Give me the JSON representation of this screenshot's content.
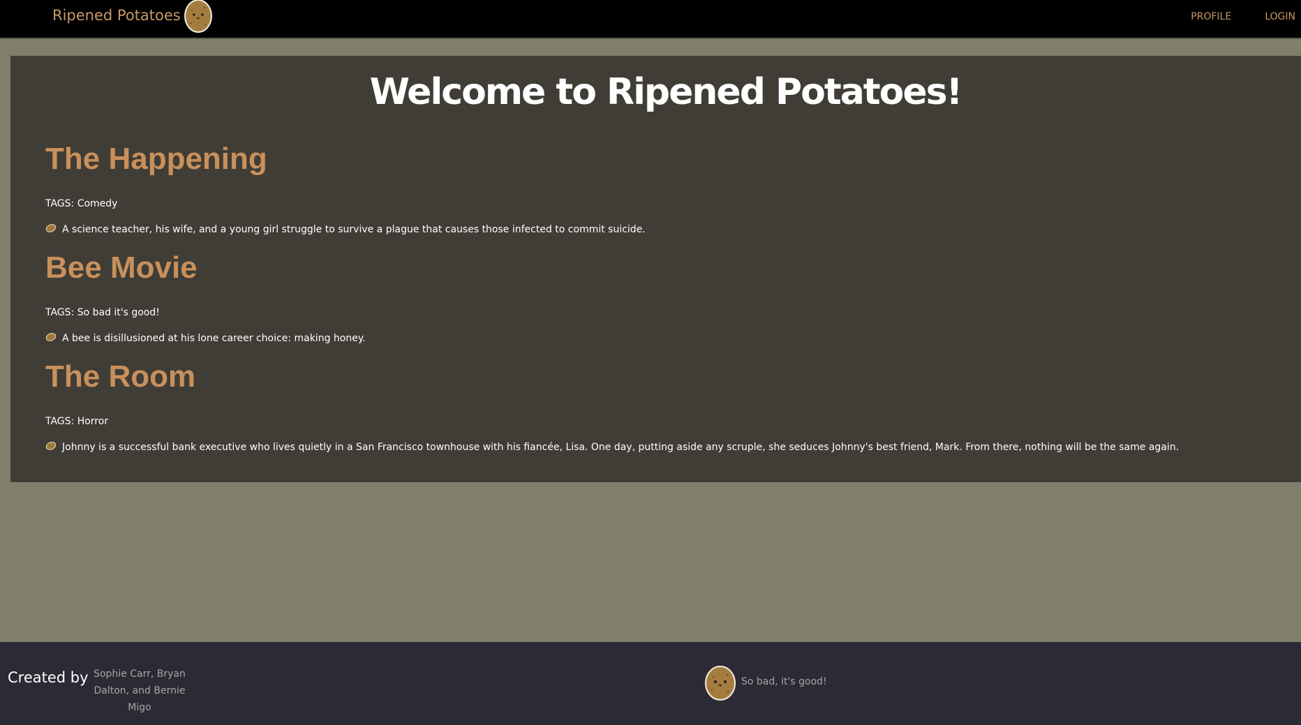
{
  "navbar": {
    "brand_text": "Ripened Potatoes",
    "brand_icon": "potato-mascot-icon",
    "links": [
      {
        "label": "PROFILE"
      },
      {
        "label": "LOGIN"
      }
    ]
  },
  "main": {
    "title": "Welcome to Ripened Potatoes!",
    "movies": [
      {
        "title": "The Happening",
        "tags": "TAGS: Comedy",
        "description": "A science teacher, his wife, and a young girl struggle to survive a plague that causes those infected to commit suicide."
      },
      {
        "title": "Bee Movie",
        "tags": "TAGS: So bad it's good!",
        "description": "A bee is disillusioned at his lone career choice: making honey."
      },
      {
        "title": "The Room",
        "tags": "TAGS: Horror",
        "description": "Johnny is a successful bank executive who lives quietly in a San Francisco townhouse with his fiancée, Lisa. One day, putting aside any scruple, she seduces Johnny's best friend, Mark. From there, nothing will be the same again."
      }
    ]
  },
  "footer": {
    "created_label": "Created by",
    "authors_line1": "Sophie Carr, Bryan",
    "authors_line2": "Dalton, and Bernie Migo",
    "tagline": "So bad, it's good!"
  },
  "colors": {
    "navbar_bg": "#000000",
    "page_bg": "#807f6b",
    "panel_bg": "#403d36",
    "accent": "#c8905c",
    "footer_bg": "#2c2a35"
  }
}
